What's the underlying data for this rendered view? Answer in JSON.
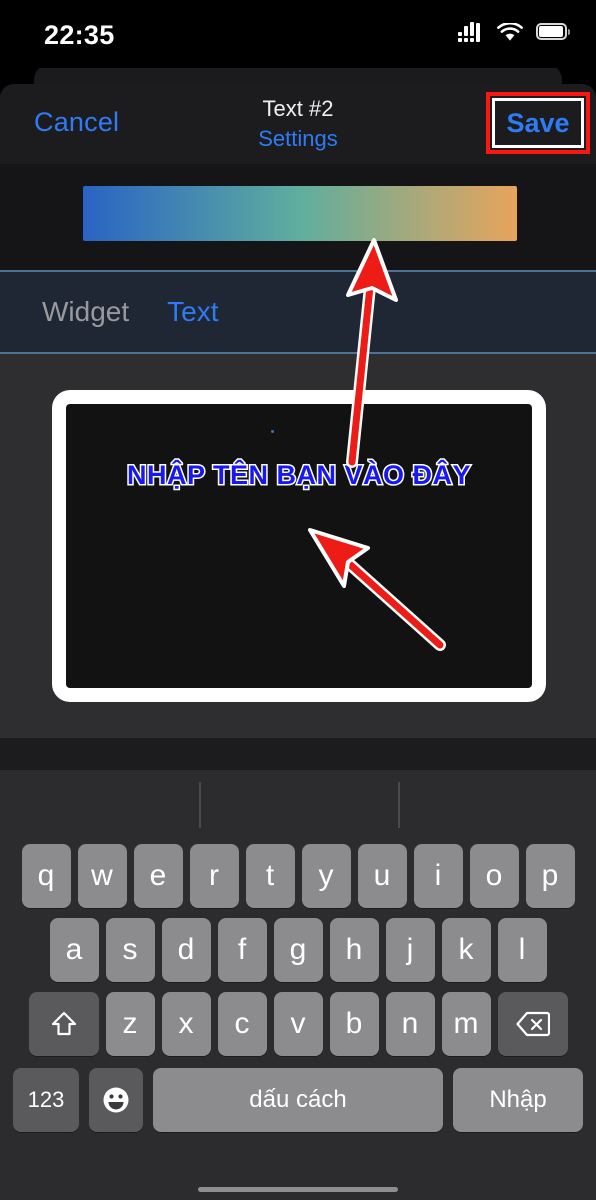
{
  "status_bar": {
    "time": "22:35",
    "cellular_icon": "cellular-signal-icon",
    "wifi_icon": "wifi-icon",
    "battery_icon": "battery-icon"
  },
  "nav": {
    "cancel_label": "Cancel",
    "title": "Text #2",
    "subtitle": "Settings",
    "save_label": "Save",
    "save_highlight_color": "#fb1612",
    "accent_color": "#2f7bf5"
  },
  "gradient": {
    "start_color": "#2a63c4",
    "mid_color": "#5fae9e",
    "end_color": "#e8a45c"
  },
  "tabs": [
    {
      "label": "Widget",
      "active": false
    },
    {
      "label": "Text",
      "active": true
    }
  ],
  "preview": {
    "text": "NHẬP TÊN BẠN VÀO ĐÂY",
    "text_color": "#1718f2",
    "outline_color": "#ffffff",
    "screen_background": "#121212",
    "frame_color": "#ffffff"
  },
  "keyboard": {
    "prediction_bar": {
      "suggestions": [
        "",
        "",
        ""
      ]
    },
    "row1": [
      "q",
      "w",
      "e",
      "r",
      "t",
      "y",
      "u",
      "i",
      "o",
      "p"
    ],
    "row2": [
      "a",
      "s",
      "d",
      "f",
      "g",
      "h",
      "j",
      "k",
      "l"
    ],
    "row3": [
      "z",
      "x",
      "c",
      "v",
      "b",
      "n",
      "m"
    ],
    "shift_icon": "shift-arrow-icon",
    "backspace_icon": "backspace-icon",
    "numbers_label": "123",
    "emoji_icon": "emoji-smiley-icon",
    "space_label": "dấu cách",
    "enter_label": "Nhập"
  },
  "annotations": {
    "arrow_color": "#ed1c16",
    "arrow_outline_color": "#ffffff",
    "arrow_to_gradient": "points up from text preview to gradient bar",
    "arrow_to_text": "points up-left at the preview text"
  }
}
